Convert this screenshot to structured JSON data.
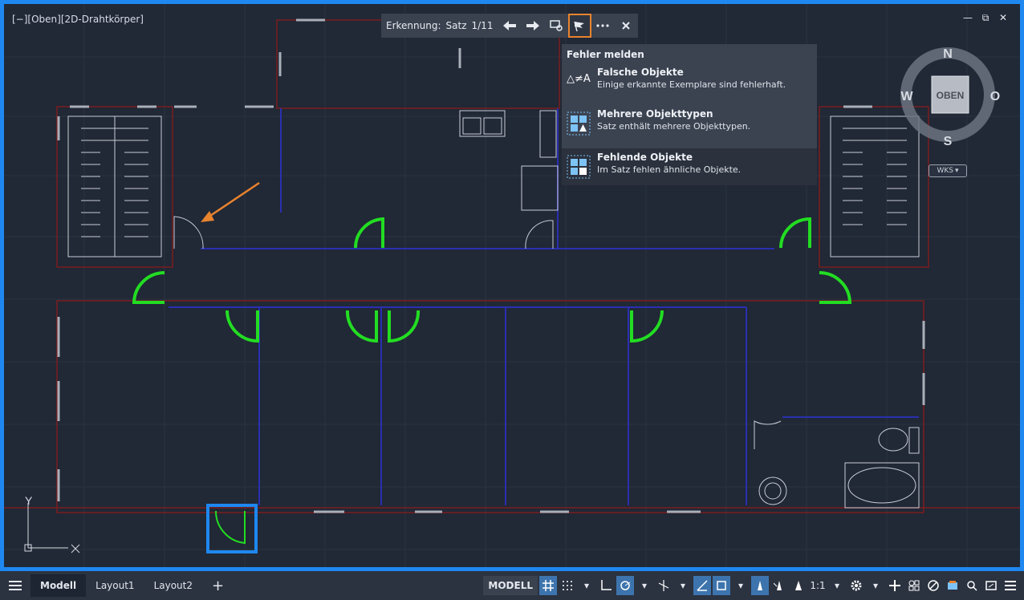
{
  "viewport": {
    "label": "[−][Oben][2D-Drahtkörper]"
  },
  "window_controls": {
    "minimize": "—",
    "restore": "⧉",
    "close": "✕"
  },
  "toolbar": {
    "label": "Erkennung:",
    "set_label": "Satz",
    "counter": "1/11",
    "icons": [
      "arrow-left-icon",
      "arrow-right-icon",
      "zoom-selection-icon",
      "report-flag-icon",
      "more-icon",
      "close-icon"
    ]
  },
  "menu": {
    "header": "Fehler melden",
    "items": [
      {
        "title": "Falsche Objekte",
        "desc": "Einige erkannte Exemplare sind fehlerhaft.",
        "icon": "not-equal-objects-icon",
        "symbol": "△≠A"
      },
      {
        "title": "Mehrere Objekttypen",
        "desc": "Satz enthält mehrere Objekttypen.",
        "icon": "multiple-types-icon"
      },
      {
        "title": "Fehlende Objekte",
        "desc": "Im Satz fehlen ähnliche Objekte.",
        "icon": "missing-objects-icon"
      }
    ]
  },
  "viewcube": {
    "north": "N",
    "south": "S",
    "west": "W",
    "east": "O",
    "face": "OBEN",
    "ucs": "WKS"
  },
  "ucs_icon": {
    "y": "Y"
  },
  "status": {
    "tabs": [
      "Modell",
      "Layout1",
      "Layout2"
    ],
    "add_tab": "+",
    "model_button": "MODELL",
    "scale": "1:1"
  },
  "colors": {
    "accent": "#1e88f0",
    "highlight": "#e8832e",
    "door": "#22dd22",
    "wall": "#2a2fb0",
    "border": "#8a1d1d"
  }
}
